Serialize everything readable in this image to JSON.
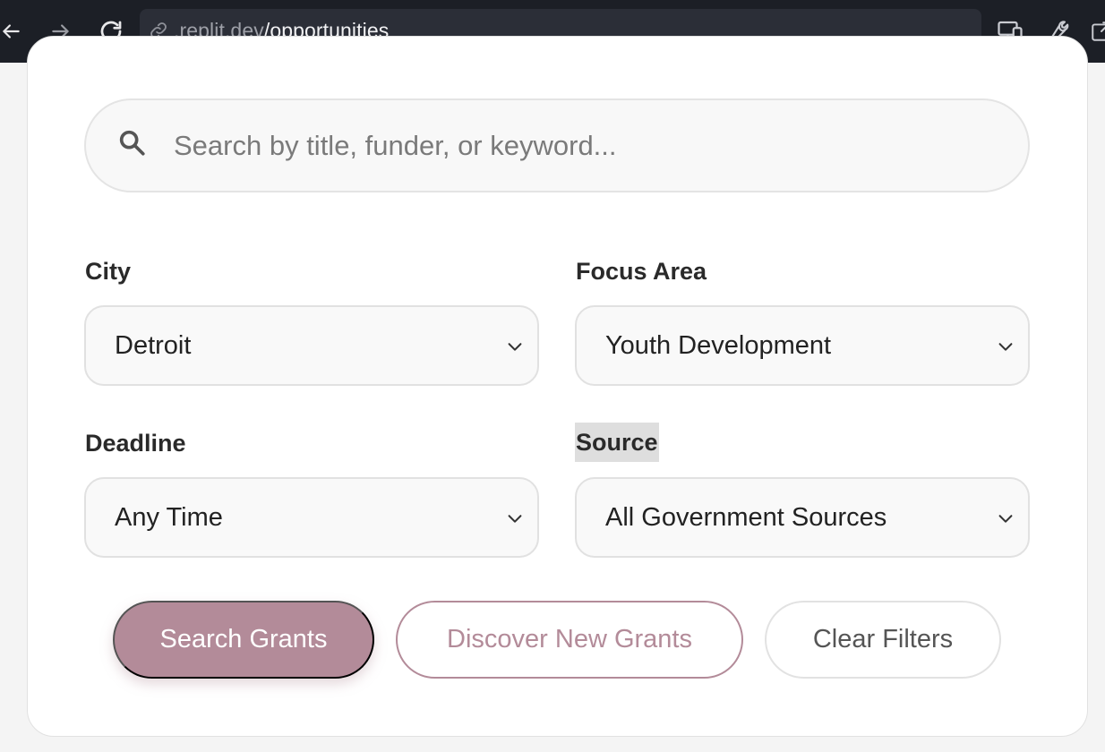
{
  "browser": {
    "url_host": ".replit.dev",
    "url_path": "/opportunities",
    "back_icon": "arrow-left-icon",
    "forward_icon": "arrow-right-icon",
    "reload_icon": "reload-icon",
    "link_icon": "link-icon",
    "devices_icon": "devices-icon",
    "wrench_icon": "wrench-icon",
    "external_icon": "external-link-icon"
  },
  "search": {
    "placeholder": "Search by title, funder, or keyword...",
    "value": "",
    "icon": "search-icon"
  },
  "filters": {
    "city": {
      "label": "City",
      "selected": "Detroit"
    },
    "focus_area": {
      "label": "Focus Area",
      "selected": "Youth Development"
    },
    "deadline": {
      "label": "Deadline",
      "selected": "Any Time"
    },
    "source": {
      "label": "Source",
      "selected": "All Government Sources"
    }
  },
  "actions": {
    "search_label": "Search Grants",
    "discover_label": "Discover New Grants",
    "clear_label": "Clear Filters"
  },
  "colors": {
    "accent": "#b38b99",
    "chrome_bg": "#1c1f26",
    "address_bg": "#2b2e37"
  }
}
